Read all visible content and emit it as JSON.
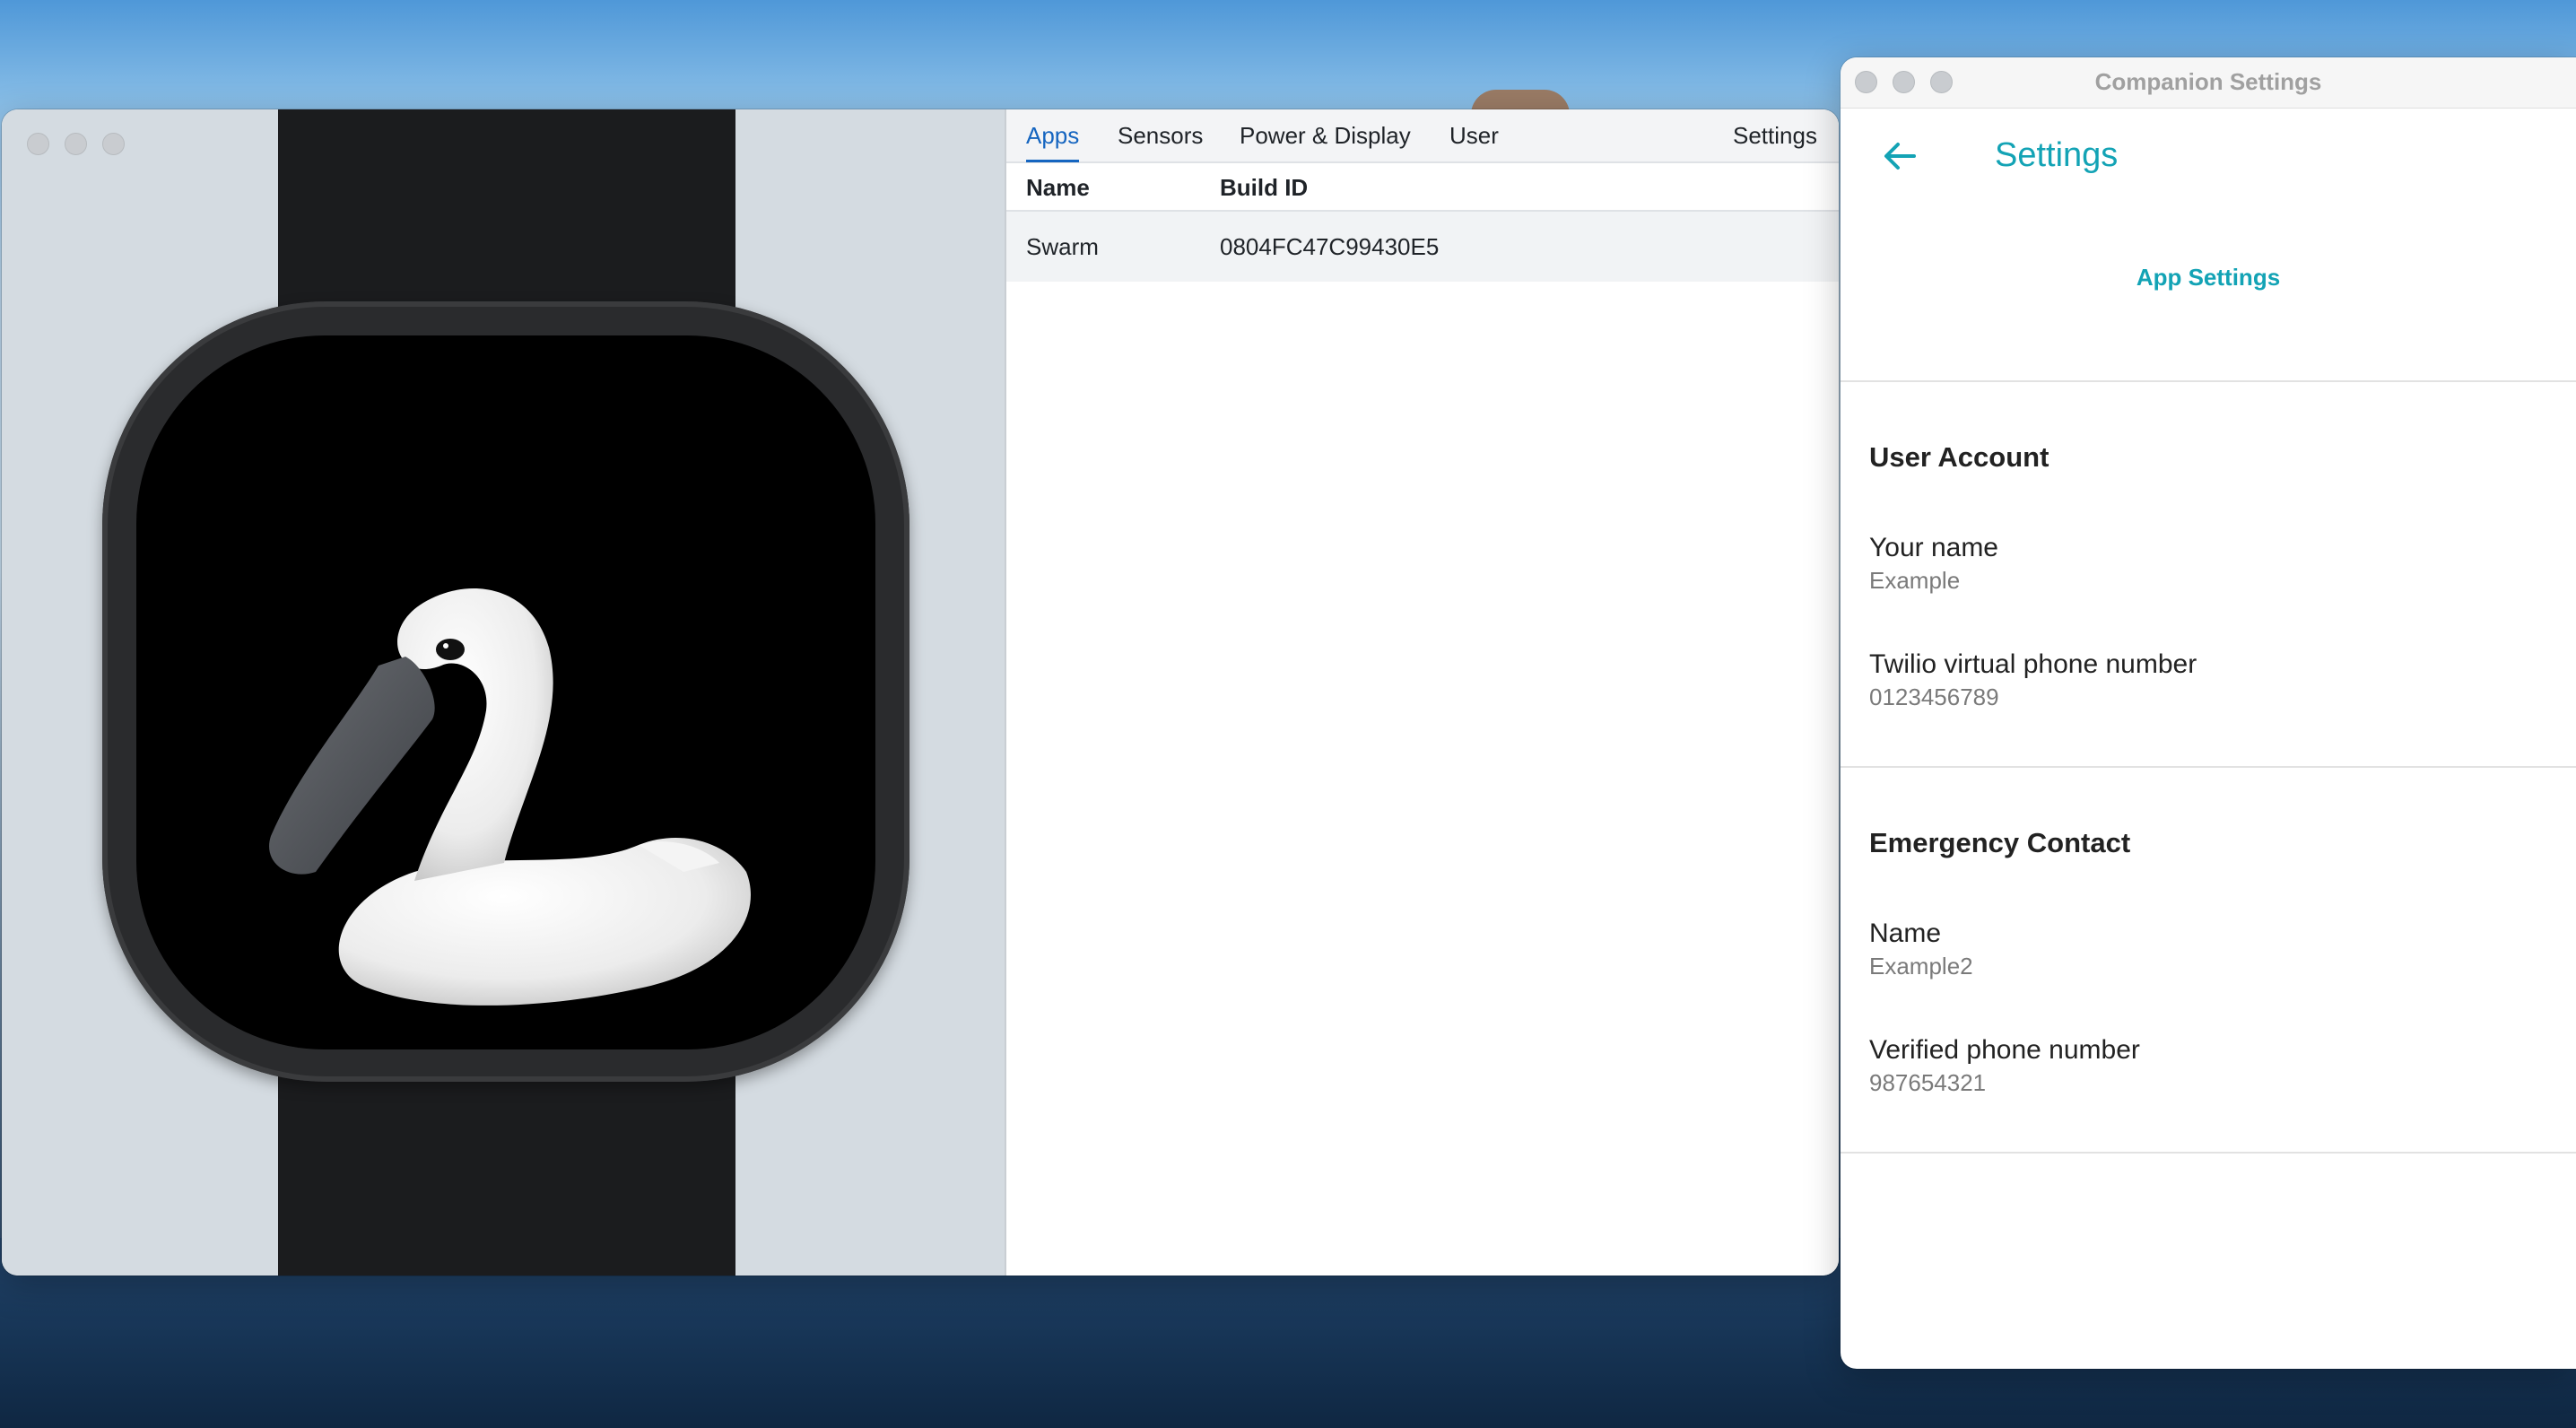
{
  "simulator": {
    "tabs": [
      {
        "label": "Apps",
        "active": true
      },
      {
        "label": "Sensors",
        "active": false
      },
      {
        "label": "Power & Display",
        "active": false
      },
      {
        "label": "User",
        "active": false
      },
      {
        "label": "Settings",
        "active": false
      }
    ],
    "table": {
      "columns": [
        "Name",
        "Build ID"
      ],
      "rows": [
        {
          "name": "Swarm",
          "build_id": "0804FC47C99430E5"
        }
      ]
    },
    "watch_face_image": "swan"
  },
  "companion": {
    "window_title": "Companion Settings",
    "page_title": "Settings",
    "back_icon": "arrow-left-icon",
    "app_settings_label": "App Settings",
    "sections": [
      {
        "title": "User Account",
        "items": [
          {
            "label": "Your name",
            "value": "Example"
          },
          {
            "label": "Twilio virtual phone number",
            "value": "0123456789"
          }
        ]
      },
      {
        "title": "Emergency Contact",
        "items": [
          {
            "label": "Name",
            "value": "Example2"
          },
          {
            "label": "Verified phone number",
            "value": "987654321"
          }
        ]
      }
    ],
    "accent_color": "#13a3b5"
  }
}
